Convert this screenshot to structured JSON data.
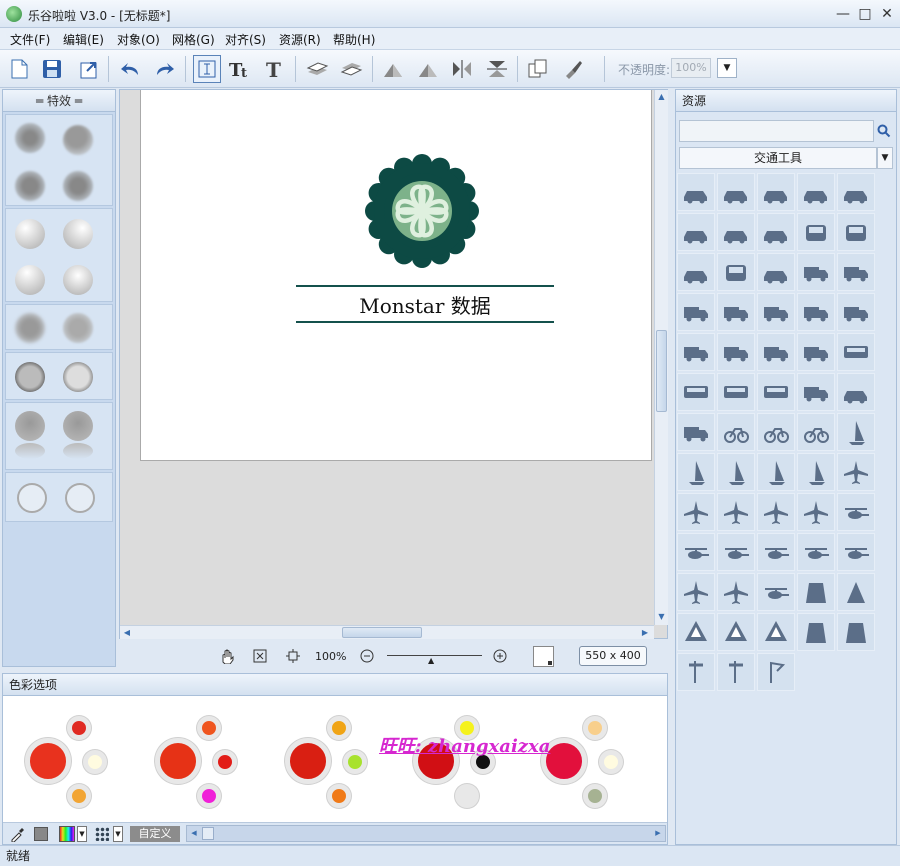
{
  "window": {
    "title": "乐谷啦啦 V3.0 - [无标题*]",
    "minimize_label": "—",
    "maximize_label": "□",
    "close_label": "✕"
  },
  "menu": [
    "文件(F)",
    "编辑(E)",
    "对象(O)",
    "网格(G)",
    "对齐(S)",
    "资源(R)",
    "帮助(H)"
  ],
  "toolbar": {
    "opacity_label": "不透明度:",
    "opacity_value": "100%"
  },
  "effects": {
    "header": "特效"
  },
  "canvas": {
    "brand_text": "Monstar 数据",
    "logo_color": "#0d4a44",
    "logo_inner_color": "#7db28a",
    "rule_color": "#14514c"
  },
  "zoom": {
    "percent": "100%",
    "size": "550 x 400"
  },
  "color_panel": {
    "header": "色彩选项",
    "custom_label": "自定义",
    "watermark": "旺旺: zhangxaizxa",
    "groups": [
      {
        "main": "#e8321e",
        "top": "#e02a22",
        "right": "#fffbe0",
        "bottom": "#f2a534"
      },
      {
        "main": "#e63216",
        "top": "#ef551f",
        "right": "#e21d18",
        "bottom": "#f020d8"
      },
      {
        "main": "#d91f12",
        "top": "#f0a415",
        "right": "#a8e22e",
        "bottom": "#f07a18"
      },
      {
        "main": "#d10f14",
        "top": "#f5f21c",
        "right": "#111111",
        "bottom": "#e8e8e8"
      },
      {
        "main": "#e2103c",
        "top": "#f8cf8c",
        "right": "#fffbe0",
        "bottom": "#a6b292"
      }
    ]
  },
  "resources": {
    "header": "资源",
    "category": "交通工具",
    "icon_color": "#5b6e88",
    "items": [
      "car-icon",
      "car-icon",
      "car-icon",
      "pickup-truck-icon",
      "car-icon",
      "car-icon",
      "car-icon",
      "car-outline-icon",
      "car-front-icon",
      "car-front-icon",
      "car-icon",
      "car-front-icon",
      "car-icon",
      "truck-icon",
      "truck-icon",
      "truck-icon",
      "truck-icon",
      "truck-icon",
      "rv-icon",
      "truck-icon",
      "truck-icon",
      "bulldozer-icon",
      "tractor-icon",
      "truck-icon",
      "bus-front-icon",
      "bus-icon",
      "bus-icon",
      "bus-icon",
      "locomotive-icon",
      "carriage-icon",
      "trolley-icon",
      "motorcycle-icon",
      "bicycle-icon",
      "scooter-icon",
      "sailboat-icon",
      "sailboat-icon",
      "sailboat-icon",
      "ship-icon",
      "windsurf-icon",
      "airplane-icon",
      "airplane-icon",
      "rocket-icon",
      "airplane-icon",
      "airplane-icon",
      "helicopter-icon",
      "helicopter-icon",
      "helicopter-icon",
      "helicopter-icon",
      "helicopter-icon",
      "helicopter-icon",
      "airplane-icon",
      "airplane-icon",
      "helicopter-icon",
      "horse-rider-icon",
      "cone-icon",
      "road-sign-icon",
      "road-sign-icon",
      "pedestrian-sign-icon",
      "tunnel-icon",
      "ufo-icon",
      "signpost-icon",
      "signpost-icon",
      "flag-icon"
    ]
  },
  "status": {
    "text": "就绪"
  }
}
